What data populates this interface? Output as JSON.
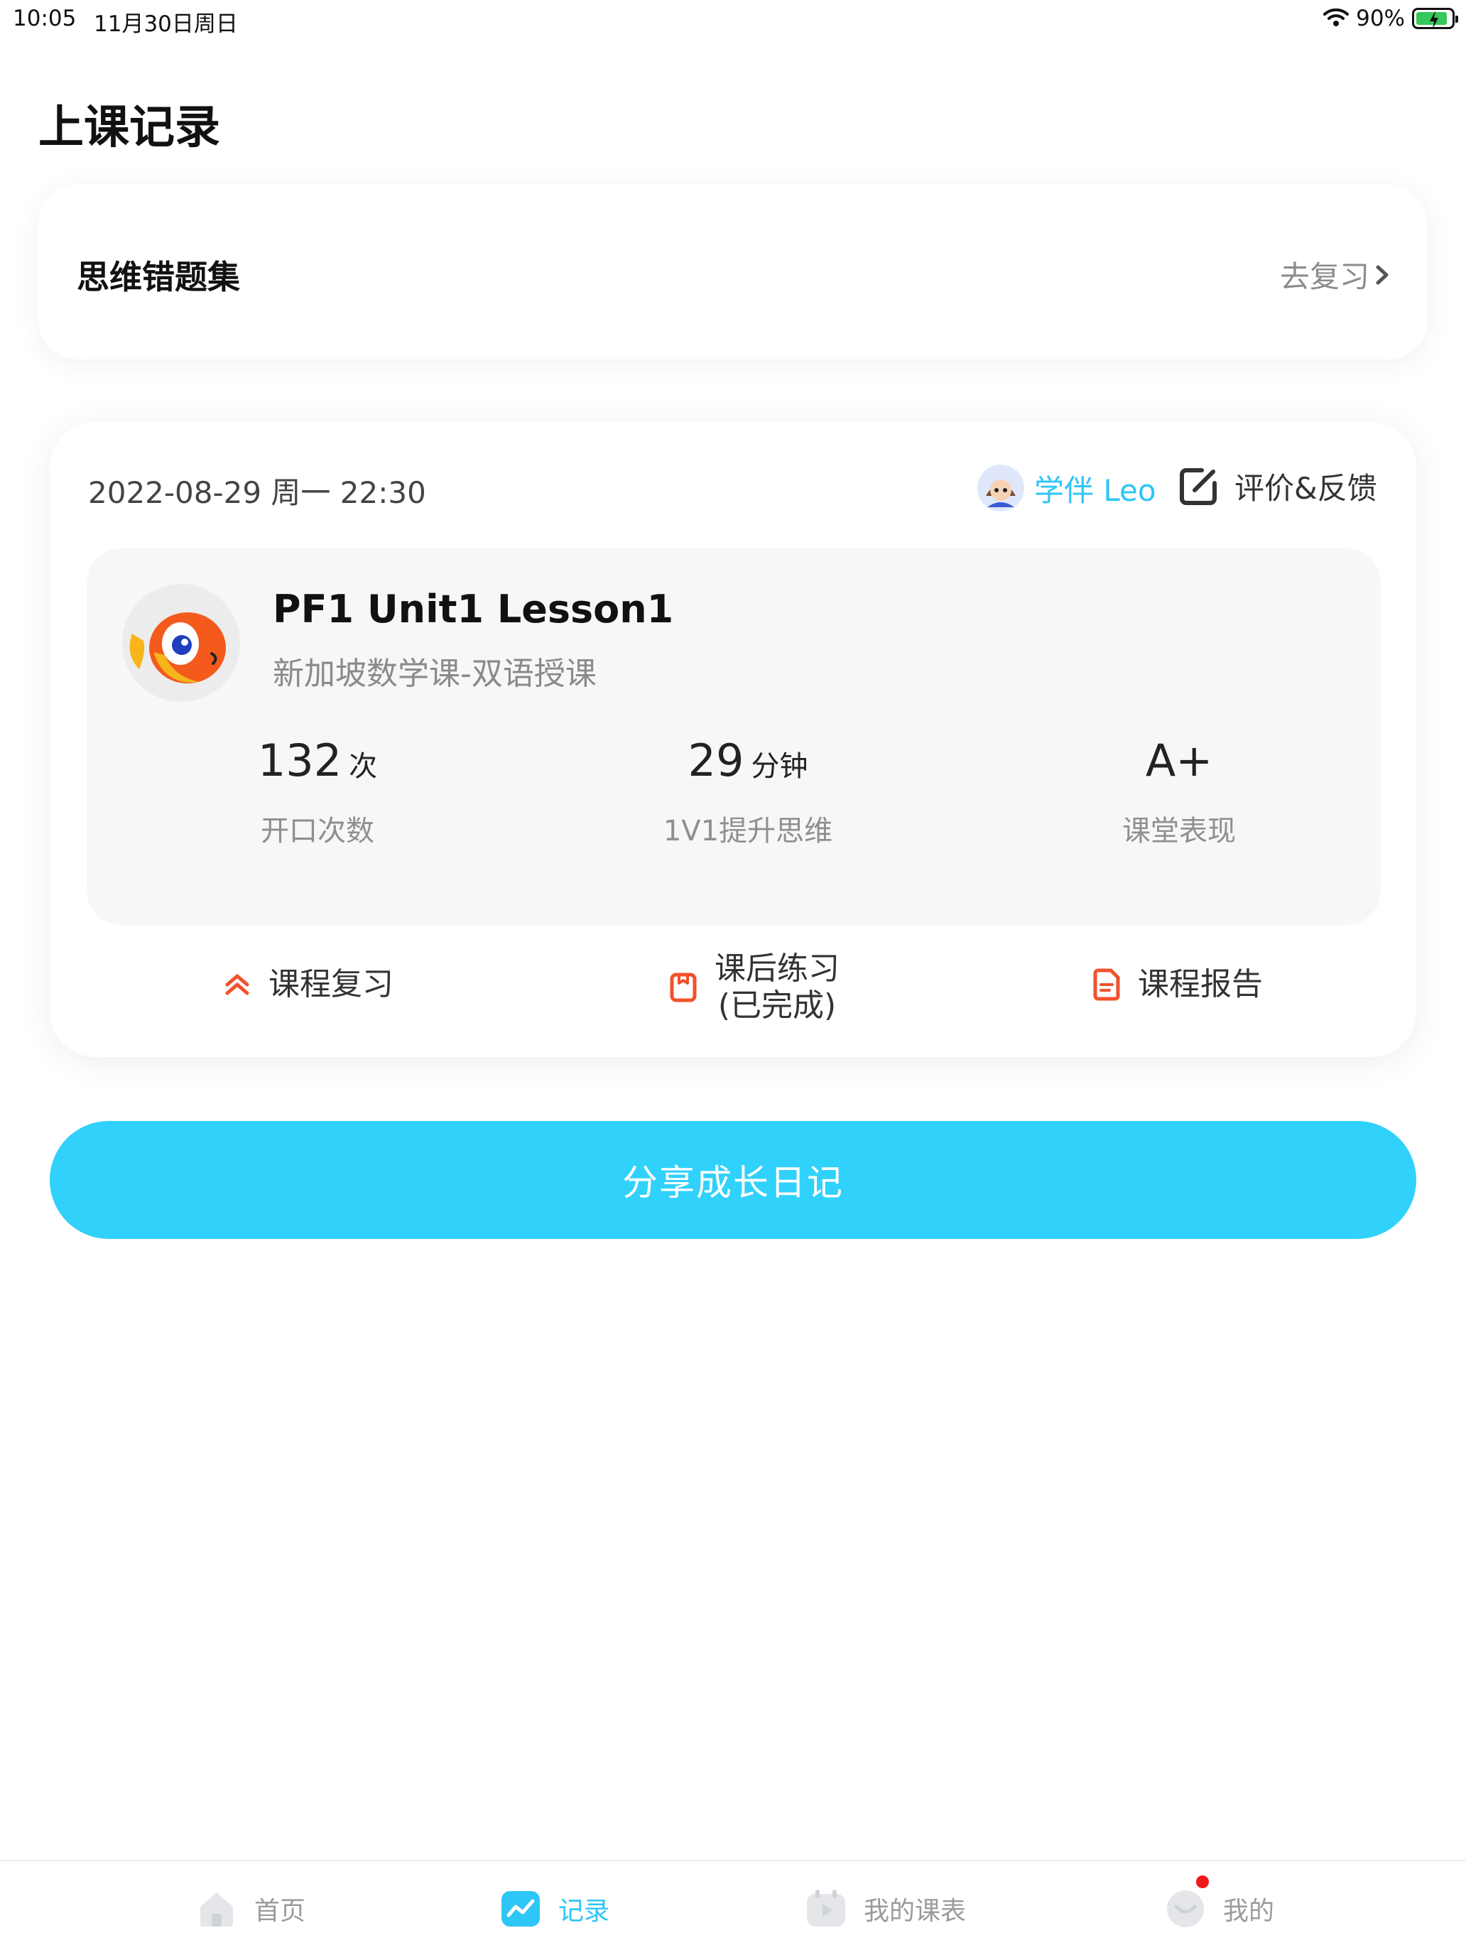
{
  "status_bar": {
    "time": "10:05",
    "date": "11月30日周日",
    "battery_percent_text": "90%",
    "battery_level": 0.9
  },
  "page": {
    "title": "上课记录"
  },
  "error_set": {
    "title": "思维错题集",
    "action_label": "去复习"
  },
  "record": {
    "datetime": "2022-08-29 周一 22:30",
    "tutor_label": "学伴 Leo",
    "feedback_label": "评价&反馈",
    "lesson": {
      "title": "PF1 Unit1 Lesson1",
      "subtitle": "新加坡数学课-双语授课",
      "stats": [
        {
          "value": "132",
          "unit": "次",
          "label": "开口次数"
        },
        {
          "value": "29",
          "unit": "分钟",
          "label": "1V1提升思维"
        },
        {
          "value": "A+",
          "unit": "",
          "label": "课堂表现"
        }
      ]
    },
    "actions": [
      {
        "label": "课程复习",
        "icon": "double-chevron-up-icon"
      },
      {
        "label_line1": "课后练习",
        "label_line2": "(已完成)",
        "icon": "notebook-icon"
      },
      {
        "label": "课程报告",
        "icon": "document-icon"
      }
    ]
  },
  "share_button": {
    "label": "分享成长日记"
  },
  "tabs": [
    {
      "label": "首页",
      "icon": "home-icon",
      "active": false
    },
    {
      "label": "记录",
      "icon": "chart-icon",
      "active": true
    },
    {
      "label": "我的课表",
      "icon": "play-calendar-icon",
      "active": false
    },
    {
      "label": "我的",
      "icon": "profile-icon",
      "active": false,
      "badge": true
    }
  ],
  "colors": {
    "accent": "#30d1fb",
    "accent_text": "#2ec5f7",
    "action_icon": "#f2512b",
    "battery": "#34c759",
    "badge": "#f01919"
  }
}
